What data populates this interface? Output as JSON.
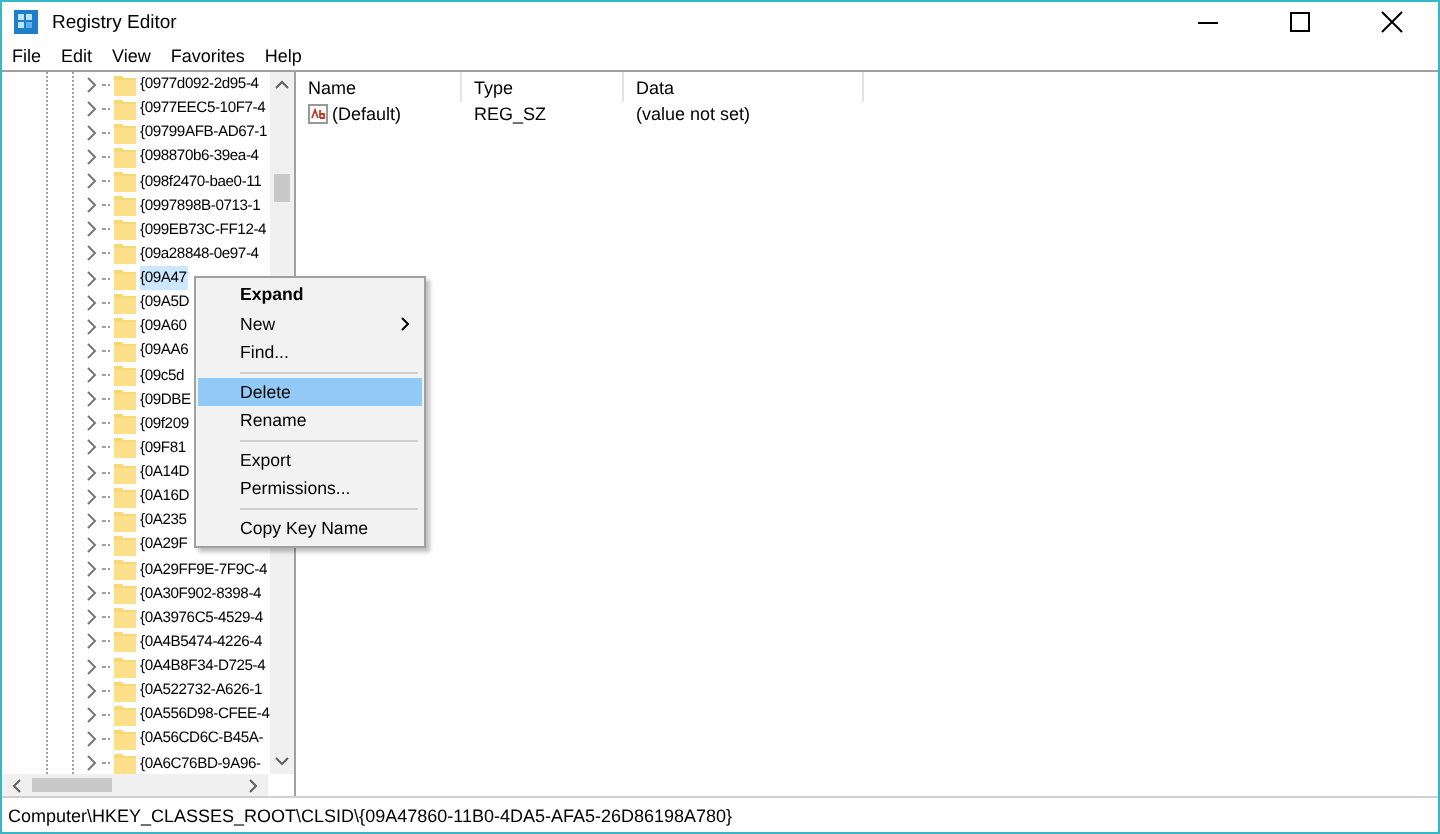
{
  "window": {
    "title": "Registry Editor"
  },
  "menu_bar": [
    "File",
    "Edit",
    "View",
    "Favorites",
    "Help"
  ],
  "tree": {
    "items": [
      {
        "label": "{0977d092-2d95-4",
        "selected": false
      },
      {
        "label": "{0977EEC5-10F7-4",
        "selected": false
      },
      {
        "label": "{09799AFB-AD67-1",
        "selected": false
      },
      {
        "label": "{098870b6-39ea-4",
        "selected": false
      },
      {
        "label": "{098f2470-bae0-11",
        "selected": false
      },
      {
        "label": "{0997898B-0713-1",
        "selected": false
      },
      {
        "label": "{099EB73C-FF12-4",
        "selected": false
      },
      {
        "label": "{09a28848-0e97-4",
        "selected": false
      },
      {
        "label": "{09A47",
        "selected": true
      },
      {
        "label": "{09A5D",
        "selected": false
      },
      {
        "label": "{09A60",
        "selected": false
      },
      {
        "label": "{09AA6",
        "selected": false
      },
      {
        "label": "{09c5d",
        "selected": false
      },
      {
        "label": "{09DBE",
        "selected": false
      },
      {
        "label": "{09f209",
        "selected": false
      },
      {
        "label": "{09F81",
        "selected": false
      },
      {
        "label": "{0A14D",
        "selected": false
      },
      {
        "label": "{0A16D",
        "selected": false
      },
      {
        "label": "{0A235",
        "selected": false
      },
      {
        "label": "{0A29F",
        "selected": false
      },
      {
        "label": "{0A29FF9E-7F9C-4",
        "selected": false
      },
      {
        "label": "{0A30F902-8398-4",
        "selected": false
      },
      {
        "label": "{0A3976C5-4529-4",
        "selected": false
      },
      {
        "label": "{0A4B5474-4226-4",
        "selected": false
      },
      {
        "label": "{0A4B8F34-D725-4",
        "selected": false
      },
      {
        "label": "{0A522732-A626-1",
        "selected": false
      },
      {
        "label": "{0A556D98-CFEE-4",
        "selected": false
      },
      {
        "label": "{0A56CD6C-B45A-",
        "selected": false
      },
      {
        "label": "{0A6C76BD-9A96-",
        "selected": false
      }
    ]
  },
  "list": {
    "columns": [
      "Name",
      "Type",
      "Data"
    ],
    "rows": [
      {
        "name": "(Default)",
        "type": "REG_SZ",
        "data": "(value not set)"
      }
    ]
  },
  "context_menu": {
    "items": [
      {
        "kind": "item",
        "label": "Expand",
        "default": true,
        "selected": false
      },
      {
        "kind": "submenu",
        "label": "New",
        "default": false,
        "selected": false
      },
      {
        "kind": "item",
        "label": "Find...",
        "default": false,
        "selected": false
      },
      {
        "kind": "separator"
      },
      {
        "kind": "item",
        "label": "Delete",
        "default": false,
        "selected": true
      },
      {
        "kind": "item",
        "label": "Rename",
        "default": false,
        "selected": false
      },
      {
        "kind": "separator"
      },
      {
        "kind": "item",
        "label": "Export",
        "default": false,
        "selected": false
      },
      {
        "kind": "item",
        "label": "Permissions...",
        "default": false,
        "selected": false
      },
      {
        "kind": "separator"
      },
      {
        "kind": "item",
        "label": "Copy Key Name",
        "default": false,
        "selected": false
      }
    ]
  },
  "status_bar": "Computer\\HKEY_CLASSES_ROOT\\CLSID\\{09A47860-11B0-4DA5-AFA5-26D86198A780}"
}
